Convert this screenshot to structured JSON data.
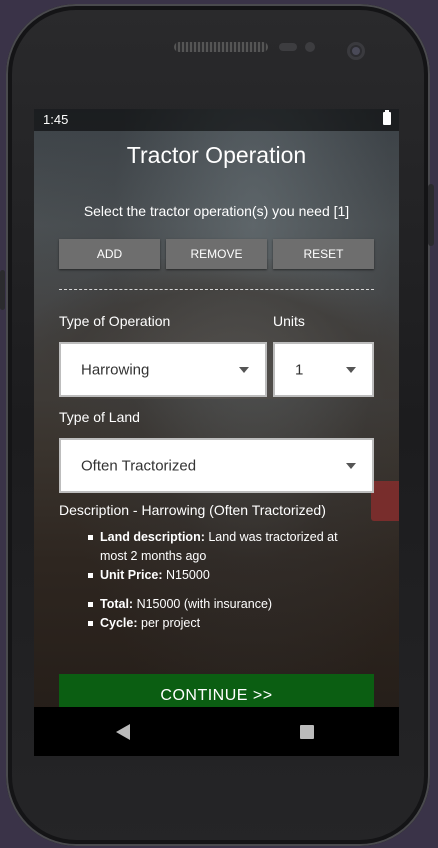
{
  "status_bar": {
    "time": "1:45"
  },
  "page": {
    "title": "Tractor Operation",
    "subtitle": "Select the tractor operation(s) you need [1]"
  },
  "actions": {
    "add": "ADD",
    "remove": "REMOVE",
    "reset": "RESET"
  },
  "form": {
    "operation_label": "Type of Operation",
    "operation_value": "Harrowing",
    "units_label": "Units",
    "units_value": "1",
    "land_label": "Type of Land",
    "land_value": "Often Tractorized"
  },
  "description": {
    "heading": "Description - Harrowing (Often Tractorized)",
    "land_key": "Land description:",
    "land_value": "Land was tractorized at most 2 months ago",
    "price_key": "Unit Price:",
    "price_value": "N15000",
    "total_key": "Total:",
    "total_value": "N15000 (with insurance)",
    "cycle_key": "Cycle:",
    "cycle_value": "per project"
  },
  "continue_label": "CONTINUE >>",
  "colors": {
    "continue_bg": "#0b5e12",
    "button_bg": "#6e6e6e"
  },
  "icons": [
    "battery-icon",
    "dropdown-caret-icon",
    "back-icon",
    "recents-icon"
  ]
}
